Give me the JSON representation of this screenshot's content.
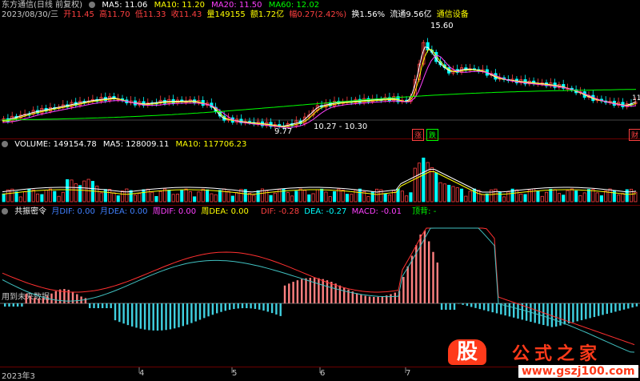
{
  "header": {
    "title": "东方通信(日线 前复权)",
    "ma_values": [
      {
        "label": "MA5: 11.06",
        "color": "#ffffff"
      },
      {
        "label": "MA10: 11.20",
        "color": "#ffff00"
      },
      {
        "label": "MA20: 11.50",
        "color": "#ff40ff"
      },
      {
        "label": "MA60: 12.02",
        "color": "#00ff00"
      }
    ],
    "date": "2023/08/30/三",
    "stats": [
      {
        "label": "开11.45",
        "color": "#ff4040"
      },
      {
        "label": "高11.70",
        "color": "#ff4040"
      },
      {
        "label": "低11.33",
        "color": "#ff4040"
      },
      {
        "label": "收11.43",
        "color": "#ff4040"
      },
      {
        "label": "量149155",
        "color": "#ffff00"
      },
      {
        "label": "额1.72亿",
        "color": "#ffff00"
      },
      {
        "label": "幅0.27(2.42%)",
        "color": "#ff4040"
      },
      {
        "label": "换1.56%",
        "color": "#ffffff"
      },
      {
        "label": "流通9.56亿",
        "color": "#ffffff"
      },
      {
        "label": "通信设备",
        "color": "#ffff00"
      }
    ],
    "annotations": {
      "high_price": "15.60",
      "low_price": "9.77",
      "range": "10.27 - 10.30",
      "tag_up": "涨",
      "tag_down": "跌",
      "tag_finance": "财",
      "edge_value": "11"
    }
  },
  "volume_panel": {
    "title": "VOLUME: 149154.78",
    "ma5": "MA5: 128009.11",
    "ma10": "MA10: 117706.23"
  },
  "indicator_panel": {
    "name": "共振密令",
    "items": [
      {
        "label": "月DIF: 0.00",
        "color": "#4080ff"
      },
      {
        "label": "月DEA: 0.00",
        "color": "#4080ff"
      },
      {
        "label": "周DIF: 0.00",
        "color": "#ff40ff"
      },
      {
        "label": "周DEA: 0.00",
        "color": "#ffff00"
      },
      {
        "label": "DIF: -0.28",
        "color": "#ff4040"
      },
      {
        "label": "DEA: -0.27",
        "color": "#00ffff"
      },
      {
        "label": "MACD: -0.01",
        "color": "#ff40ff"
      },
      {
        "label": "顶背: -",
        "color": "#00ff00"
      }
    ],
    "footer_note": "用到未来数据"
  },
  "timeline": {
    "labels": [
      {
        "text": "2023年3",
        "pos": "start"
      },
      {
        "text": "4"
      },
      {
        "text": "5"
      },
      {
        "text": "6"
      },
      {
        "text": "7"
      }
    ]
  },
  "watermark": {
    "logo_char": "股",
    "brand": "公式之家",
    "url": "www.gszj100.com"
  },
  "colors": {
    "up": "#ff4040",
    "down": "#00ffff",
    "ma5": "#ffffff",
    "ma10": "#ffff00",
    "ma20": "#ff40ff",
    "ma60": "#00ff00",
    "grid": "#6b0000"
  }
}
